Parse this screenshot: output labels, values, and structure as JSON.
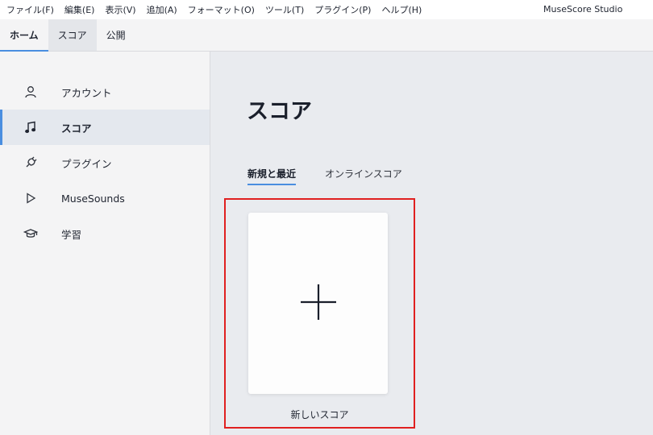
{
  "menu": {
    "items": [
      "ファイル(F)",
      "編集(E)",
      "表示(V)",
      "追加(A)",
      "フォーマット(O)",
      "ツール(T)",
      "プラグイン(P)",
      "ヘルプ(H)"
    ],
    "app_title": "MuseScore Studio"
  },
  "tabs": [
    {
      "label": "ホーム"
    },
    {
      "label": "スコア"
    },
    {
      "label": "公開"
    }
  ],
  "sidebar": {
    "items": [
      {
        "label": "アカウント",
        "icon": "account-icon"
      },
      {
        "label": "スコア",
        "icon": "music-note-icon"
      },
      {
        "label": "プラグイン",
        "icon": "plugin-icon"
      },
      {
        "label": "MuseSounds",
        "icon": "play-icon"
      },
      {
        "label": "学習",
        "icon": "graduation-cap-icon"
      }
    ]
  },
  "content": {
    "title": "スコア",
    "subtabs": [
      {
        "label": "新規と最近"
      },
      {
        "label": "オンラインスコア"
      }
    ],
    "new_score_label": "新しいスコア"
  },
  "colors": {
    "accent": "#4a8ee0",
    "highlight_border": "#e02020",
    "content_bg": "#e9ebef",
    "sidebar_bg": "#f4f4f5"
  }
}
